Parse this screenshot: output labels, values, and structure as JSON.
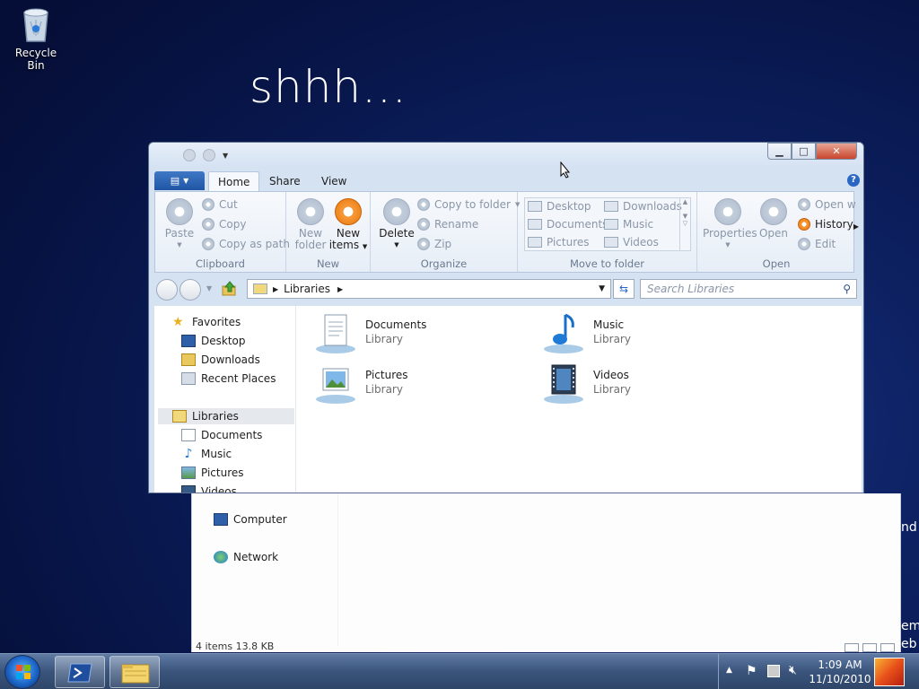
{
  "desktop": {
    "recycle_bin": "Recycle Bin",
    "overlay_text": "shhh...",
    "right_fragments": [
      "nd",
      "em",
      "eb"
    ]
  },
  "ribbon": {
    "file_tab": "",
    "tabs": [
      "Home",
      "Share",
      "View"
    ],
    "active_tab": "Home",
    "help": "?",
    "clipboard": {
      "paste": "Paste",
      "cut": "Cut",
      "copy": "Copy",
      "copy_as_path": "Copy as path",
      "label": "Clipboard"
    },
    "new": {
      "new_folder": "New folder",
      "new_items": "New items",
      "label": "New"
    },
    "organize": {
      "delete": "Delete",
      "copy_to_folder": "Copy to folder",
      "rename": "Rename",
      "zip": "Zip",
      "label": "Organize"
    },
    "move_to_folder": {
      "items": [
        "Desktop",
        "Downloads",
        "Documents",
        "Music",
        "Pictures",
        "Videos"
      ],
      "label": "Move to folder"
    },
    "open": {
      "properties": "Properties",
      "open": "Open",
      "open_with": "Open w",
      "history": "History",
      "edit": "Edit",
      "label": "Open"
    }
  },
  "address": {
    "path": [
      "Libraries"
    ],
    "search_placeholder": "Search Libraries"
  },
  "nav": {
    "favorites": "Favorites",
    "favorites_items": [
      "Desktop",
      "Downloads",
      "Recent Places"
    ],
    "libraries": "Libraries",
    "libraries_items": [
      "Documents",
      "Music",
      "Pictures",
      "Videos"
    ],
    "computer": "Computer",
    "network": "Network"
  },
  "content": {
    "libraries": [
      {
        "name": "Documents",
        "type": "Library"
      },
      {
        "name": "Music",
        "type": "Library"
      },
      {
        "name": "Pictures",
        "type": "Library"
      },
      {
        "name": "Videos",
        "type": "Library"
      }
    ]
  },
  "status": {
    "text": "4 items  13.8 KB"
  },
  "taskbar": {
    "time": "1:09 AM",
    "date": "11/10/2010"
  },
  "colors": {
    "accent_orange": "#e97808",
    "ribbon_blue": "#1f56a6",
    "desktop_bg": "#0c1f5e"
  }
}
